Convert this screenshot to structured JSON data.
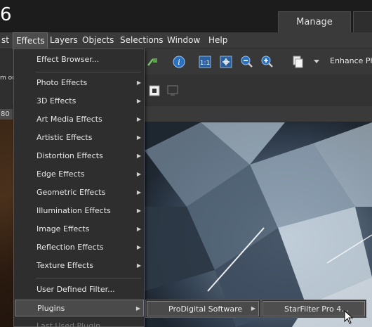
{
  "app": {
    "title_fragment": "6"
  },
  "tabs": {
    "manage": "Manage"
  },
  "menubar": {
    "items": [
      "st",
      "Effects",
      "Layers",
      "Objects",
      "Selections",
      "Window",
      "Help"
    ]
  },
  "toolbar": {
    "enhance_label": "Enhance Ph",
    "icons": [
      "share-icon",
      "effects-icon",
      "info-icon",
      "actual-size-icon",
      "fit-window-icon",
      "zoom-out-icon",
      "zoom-in-icon",
      "copy-icon",
      "dropdown-arrow-icon"
    ]
  },
  "left_fragments": {
    "zoom_text": "m ou",
    "zoom_value": "80"
  },
  "effects_menu": {
    "items": [
      {
        "label": "Effect Browser...",
        "submenu": false
      },
      {
        "label": "Photo Effects",
        "submenu": true
      },
      {
        "label": "3D Effects",
        "submenu": true
      },
      {
        "label": "Art Media Effects",
        "submenu": true
      },
      {
        "label": "Artistic Effects",
        "submenu": true
      },
      {
        "label": "Distortion Effects",
        "submenu": true
      },
      {
        "label": "Edge Effects",
        "submenu": true
      },
      {
        "label": "Geometric Effects",
        "submenu": true
      },
      {
        "label": "Illumination Effects",
        "submenu": true
      },
      {
        "label": "Image Effects",
        "submenu": true
      },
      {
        "label": "Reflection Effects",
        "submenu": true
      },
      {
        "label": "Texture Effects",
        "submenu": true
      },
      {
        "label": "User Defined Filter...",
        "submenu": false
      },
      {
        "label": "Plugins",
        "submenu": true
      },
      {
        "label": "Last Used Plugin",
        "submenu": false
      }
    ]
  },
  "plugins_submenu": {
    "label": "ProDigital Software"
  },
  "prodigital_submenu": {
    "label": "StarFilter Pro 4..."
  },
  "colors": {
    "accent": "#4a4a4a",
    "background": "#2b2b2b"
  }
}
